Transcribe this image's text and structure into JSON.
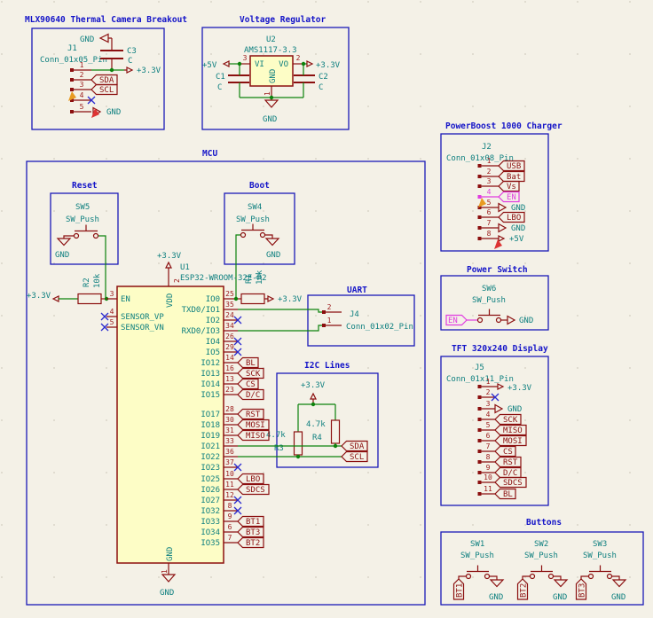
{
  "schematic": {
    "bg": "#f4f1e7",
    "colors": {
      "box": "#1a1ab8",
      "symbol": "#8b0f0f",
      "wire": "#0c820c",
      "field": "#0d7f7f",
      "body_fill": "#fdfdc6",
      "highlight": "#e03ce0",
      "noconnect": "#2a2ad0"
    }
  },
  "mlx": {
    "title": "MLX90640 Thermal Camera Breakout",
    "ref": "J1",
    "value": "Conn_01x05_Pin",
    "gnd_top": "GND",
    "cap_ref": "C3",
    "cap_val": "C",
    "net33": "+3.3V",
    "nums": [
      "1",
      "2",
      "3",
      "4",
      "5"
    ],
    "sda": "SDA",
    "scl": "SCL",
    "gnd": "GND"
  },
  "vreg": {
    "title": "Voltage Regulator",
    "ref": "U2",
    "value": "AMS1117-3.3",
    "vi": "VI",
    "vo": "VO",
    "gnd_pin": "GND",
    "n1": "1",
    "n2": "2",
    "n3": "3",
    "p5": "+5V",
    "p33": "+3.3V",
    "c1_ref": "C1",
    "c1_val": "C",
    "c2_ref": "C2",
    "c2_val": "C",
    "gnd": "GND"
  },
  "boost": {
    "title": "PowerBoost 1000 Charger",
    "ref": "J2",
    "value": "Conn_01x08_Pin",
    "pins": [
      {
        "num": "1",
        "label": "USB"
      },
      {
        "num": "2",
        "label": "Bat"
      },
      {
        "num": "3",
        "label": "Vs"
      },
      {
        "num": "4",
        "label": "EN"
      },
      {
        "num": "5",
        "label": "GND"
      },
      {
        "num": "6",
        "label": "LBO"
      },
      {
        "num": "7",
        "label": "GND"
      },
      {
        "num": "8",
        "label": "+5V"
      }
    ]
  },
  "pswitch": {
    "title": "Power Switch",
    "ref": "SW6",
    "value": "SW_Push",
    "en": "EN",
    "gnd": "GND"
  },
  "tft": {
    "title": "TFT 320x240 Display",
    "ref": "J5",
    "value": "Conn_01x11_Pin",
    "pins": [
      {
        "num": "1",
        "label": "+3.3V"
      },
      {
        "num": "2",
        "label": ""
      },
      {
        "num": "3",
        "label": "GND"
      },
      {
        "num": "4",
        "label": "SCK"
      },
      {
        "num": "5",
        "label": "MISO"
      },
      {
        "num": "6",
        "label": "MOSI"
      },
      {
        "num": "7",
        "label": "CS"
      },
      {
        "num": "8",
        "label": "RST"
      },
      {
        "num": "9",
        "label": "D/C"
      },
      {
        "num": "10",
        "label": "SDCS"
      },
      {
        "num": "11",
        "label": "BL"
      }
    ]
  },
  "buttons": {
    "title": "Buttons",
    "sw": [
      {
        "ref": "SW1",
        "value": "SW_Push",
        "label": "BT1",
        "gnd": "GND"
      },
      {
        "ref": "SW2",
        "value": "SW_Push",
        "label": "BT2",
        "gnd": "GND"
      },
      {
        "ref": "SW3",
        "value": "SW_Push",
        "label": "BT3",
        "gnd": "GND"
      }
    ]
  },
  "mcu": {
    "title": "MCU",
    "reset": {
      "title": "Reset",
      "ref": "SW5",
      "value": "SW_Push",
      "gnd": "GND"
    },
    "boot": {
      "title": "Boot",
      "ref": "SW4",
      "value": "SW_Push",
      "gnd": "GND"
    },
    "r2": {
      "ref": "R2",
      "value": "10k",
      "net": "+3.3V"
    },
    "r1": {
      "ref": "R1",
      "value": "10k",
      "net": "+3.3V"
    },
    "u1": {
      "ref": "U1",
      "value": "ESP32-WROOM-32E-R2",
      "p33": "+3.3V",
      "vdd": "VDD",
      "vdd_num": "2",
      "gnd": "GND",
      "gnd_num": "1",
      "gnd_net": "GND",
      "left": [
        {
          "num": "3",
          "name": "EN"
        },
        {
          "num": "4",
          "name": "SENSOR_VP"
        },
        {
          "num": "5",
          "name": "SENSOR_VN"
        }
      ],
      "right": [
        {
          "num": "25",
          "name": "IO0",
          "label": ""
        },
        {
          "num": "35",
          "name": "TXD0/IO1",
          "label": ""
        },
        {
          "num": "24",
          "name": "IO2",
          "label": ""
        },
        {
          "num": "34",
          "name": "RXD0/IO3",
          "label": ""
        },
        {
          "num": "26",
          "name": "IO4",
          "label": ""
        },
        {
          "num": "29",
          "name": "IO5",
          "label": ""
        },
        {
          "num": "14",
          "name": "IO12",
          "label": "BL"
        },
        {
          "num": "16",
          "name": "IO13",
          "label": "SCK"
        },
        {
          "num": "13",
          "name": "IO14",
          "label": "CS"
        },
        {
          "num": "23",
          "name": "IO15",
          "label": "D/C"
        },
        {
          "num": "28",
          "name": "IO17",
          "label": "RST"
        },
        {
          "num": "30",
          "name": "IO18",
          "label": "MOSI"
        },
        {
          "num": "31",
          "name": "IO19",
          "label": "MISO"
        },
        {
          "num": "33",
          "name": "IO21",
          "label": ""
        },
        {
          "num": "36",
          "name": "IO22",
          "label": ""
        },
        {
          "num": "37",
          "name": "IO23",
          "label": ""
        },
        {
          "num": "10",
          "name": "IO25",
          "label": "LBO"
        },
        {
          "num": "11",
          "name": "IO26",
          "label": "SDCS"
        },
        {
          "num": "12",
          "name": "IO27",
          "label": ""
        },
        {
          "num": "8",
          "name": "IO32",
          "label": ""
        },
        {
          "num": "9",
          "name": "IO33",
          "label": "BT1"
        },
        {
          "num": "6",
          "name": "IO34",
          "label": "BT3"
        },
        {
          "num": "7",
          "name": "IO35",
          "label": "BT2"
        }
      ]
    },
    "uart": {
      "title": "UART",
      "ref": "J4",
      "value": "Conn_01x02_Pin",
      "n1": "1",
      "n2": "2"
    },
    "i2c": {
      "title": "I2C Lines",
      "net": "+3.3V",
      "r3_ref": "R3",
      "r3_val": "4.7k",
      "r4_ref": "R4",
      "r4_val": "4.7k",
      "sda": "SDA",
      "scl": "SCL"
    }
  }
}
